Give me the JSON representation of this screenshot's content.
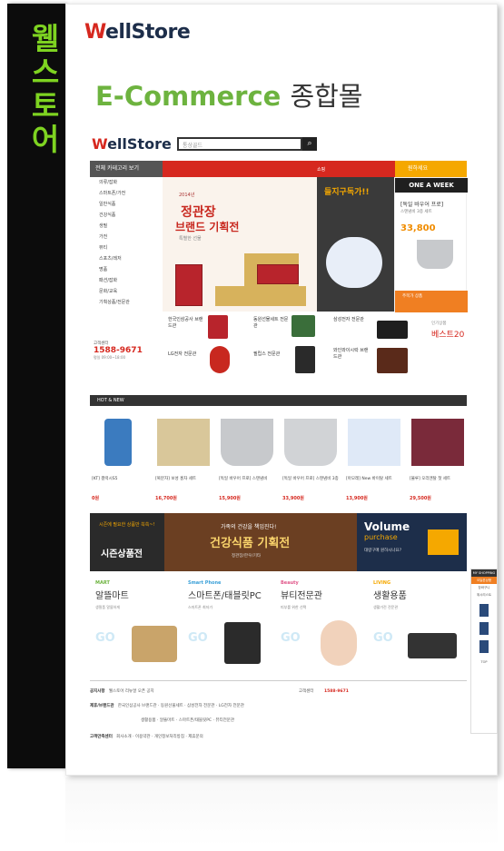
{
  "spine": {
    "text": [
      "웰",
      "스",
      "토",
      "어"
    ]
  },
  "box": {
    "logo_accent": "W",
    "logo_rest": "ellStore",
    "headline_en": "E-Commerce",
    "headline_kr": "종합몰"
  },
  "site": {
    "logo_accent": "W",
    "logo_rest": "ellStore",
    "search_placeholder": "통상골드",
    "search_icon": "magnifier",
    "nav": {
      "all_categories": "전체 카테고리 보기",
      "mid": "쇼핑",
      "right": "원하세요"
    },
    "categories": [
      "의류/잡화",
      "스마트폰/가전",
      "일반식품",
      "건강식품",
      "생필",
      "가전",
      "뷰티",
      "스포츠/레저",
      "명품",
      "패션/잡화",
      "문화/교육",
      "기획상품/전문관"
    ],
    "banner": {
      "year": "2014년",
      "title1": "정관장",
      "title2": "브랜드 기획전",
      "subtitle": "특별한 선물"
    },
    "promo": {
      "title": "들지구독가!!"
    },
    "one_week": {
      "header": "ONE A WEEK",
      "name": "[독일 바우어 프로]",
      "desc": "스텐냄비 3종 세트",
      "price": "33,800",
      "footer": "주목가 상품"
    },
    "brands": [
      {
        "label": "한국인삼공사 브랜드관"
      },
      {
        "label": "동원선물세트 전문관"
      },
      {
        "label": "삼성전자 전문관"
      },
      {
        "label": "LG전자 전문관"
      },
      {
        "label": "필립스 전문관"
      },
      {
        "label": "와인와이시락 브랜드관"
      }
    ],
    "best": {
      "label": "인기상품",
      "title": "베스트20"
    },
    "cs": {
      "label": "고객센터",
      "phone": "1588-9671",
      "hours": "평일 09:00~18:00"
    },
    "hot_label": "HOT & NEW",
    "products": [
      {
        "name": "[KT] 갤럭시S5",
        "price": "0원"
      },
      {
        "name": "[복분자] 보성 홍차 세트",
        "price": "16,700원"
      },
      {
        "name": "[독일 바우어 프로] 스텐냄비",
        "price": "15,900원"
      },
      {
        "name": "[독일 바우어 프로] 스텐냄비 3종",
        "price": "33,900원"
      },
      {
        "name": "[아모레] New 바이탈 세트",
        "price": "13,900원"
      },
      {
        "name": "[불루] 오리엔탈 첫 세트",
        "price": "29,500원"
      }
    ],
    "season": {
      "tag": "시즌에 필요한 상품만 쏙쏙~!",
      "label": "시즌상품전",
      "mid_top": "가족의 건강을 책임진다!",
      "mid_title": "건강식품 기획전",
      "mid_sub": "정관장/한우/기타",
      "vol_en": "Volume",
      "vol_sub": "purchase",
      "vol_desc": "대량구매 원하시나요?"
    },
    "cats4": [
      {
        "en": "MART",
        "kr": "알뜰마트",
        "desc": "생필품 알뜰하게",
        "go": "GO",
        "color": "#6db33f"
      },
      {
        "en": "Smart Phone",
        "kr": "스마트폰/태블릿PC",
        "desc": "스마트폰 최저가",
        "go": "GO",
        "color": "#3aa0d8"
      },
      {
        "en": "Beauty",
        "kr": "뷰티전문관",
        "desc": "피부를 위한 선택",
        "go": "GO",
        "color": "#e0578a"
      },
      {
        "en": "LIVING",
        "kr": "생활용품",
        "desc": "생활가전 전문관",
        "go": "GO",
        "color": "#f5a800"
      }
    ],
    "footer": {
      "row1_label": "공지사항",
      "row1_text": "웰스토어 리뉴얼 오픈 공지",
      "row1_cs": "고객센터",
      "row1_phone": "1588-9671",
      "row2_label": "제휴/브랜드관",
      "row2_text": "한국인삼공사 브랜드관 · 동원선물세트 · 삼성전자 전문관 · LG전자 전문관",
      "row3_text": "생활용품 · 알뜰마트 · 스마트폰/태블릿PC · 뷰티전문관",
      "row4_label": "고객만족센터",
      "row4_text": "회사소개 · 이용약관 · 개인정보처리방침 · 제휴문의"
    },
    "sidewidget": {
      "header": "MY SHOPPING",
      "tab": "오늘본상품",
      "items": [
        "장바구니",
        "위시리스트",
        "TOP"
      ]
    }
  }
}
